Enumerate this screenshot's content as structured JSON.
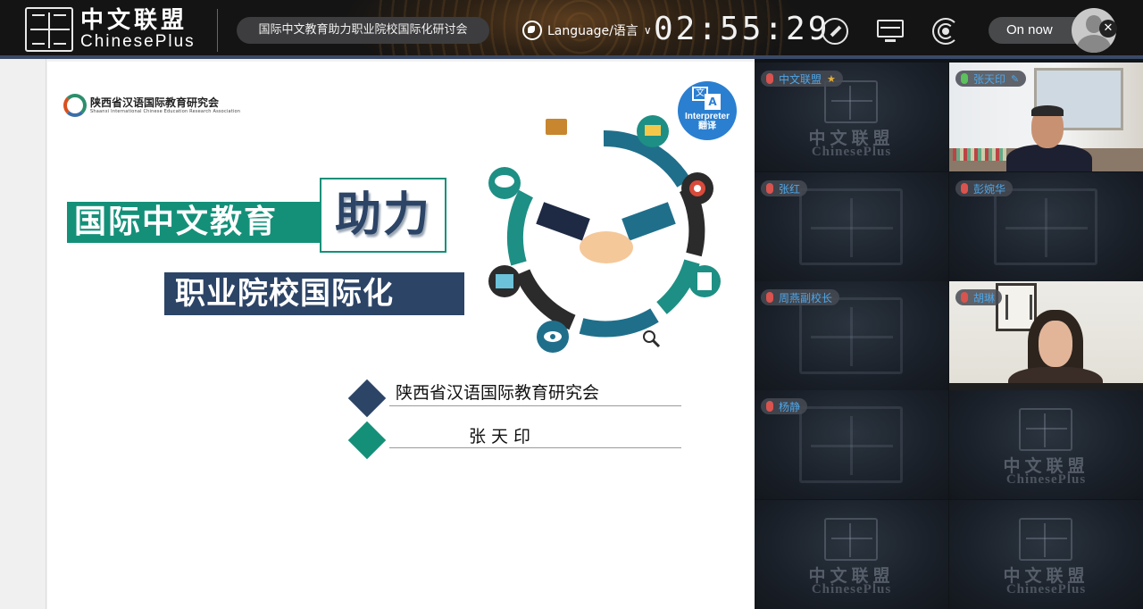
{
  "app": {
    "brand_cn": "中文联盟",
    "brand_en": "ChinesePlus",
    "meeting_title": "国际中文教育助力职业院校国际化研讨会",
    "language_label": "Language/语言",
    "timer": "02:55:29",
    "on_now_label": "On now",
    "accent_color": "#2a7fd1"
  },
  "slide": {
    "org_name_cn": "陕西省汉语国际教育研究会",
    "org_name_en": "Shaanxi International Chinese Education Research Association",
    "interpreter_en": "Interpreter",
    "interpreter_cn": "翻译",
    "title_line1": "国际中文教育",
    "title_highlight": "助力",
    "title_line2": "职业院校国际化",
    "presenter_org": "陕西省汉语国际教育研究会",
    "presenter_name": "张天印",
    "colors": {
      "teal": "#149079",
      "navy": "#2c4466"
    }
  },
  "watermark": {
    "cn": "中文联盟",
    "en": "ChinesePlus"
  },
  "participants": [
    {
      "name": "中文联盟",
      "mic": "muted",
      "host": true
    },
    {
      "name": "张天印",
      "mic": "on",
      "speaking": true,
      "video": true
    },
    {
      "name": "张红",
      "mic": "muted"
    },
    {
      "name": "彭婉华",
      "mic": "muted"
    },
    {
      "name": "周燕副校长",
      "mic": "muted"
    },
    {
      "name": "胡琳",
      "mic": "muted",
      "video": true
    },
    {
      "name": "杨静",
      "mic": "muted"
    }
  ]
}
